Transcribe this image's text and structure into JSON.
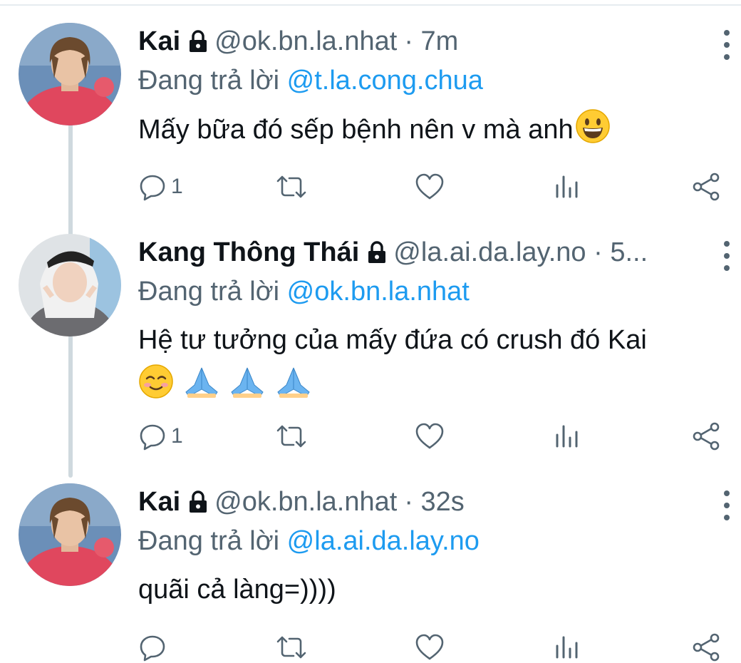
{
  "tweets": [
    {
      "name": "Kai",
      "handle": "@ok.bn.la.nhat",
      "time": "· 7m",
      "replying_label": "Đang trả lời",
      "replying_to": "@t.la.cong.chua",
      "text": "Mấy bữa đó sếp bệnh nên v mà anh",
      "emojis": [
        "grinning-face"
      ],
      "reply_count": "1",
      "avatar": "avatar-kai"
    },
    {
      "name": "Kang Thông Thái",
      "handle": "@la.ai.da.lay.no · 5...",
      "time": "",
      "replying_label": "Đang trả lời",
      "replying_to": "@ok.bn.la.nhat",
      "text": "Hệ tư tưởng của mấy đứa có crush đó Kai",
      "emojis": [
        "smiling-face",
        "folded-hands",
        "folded-hands",
        "folded-hands"
      ],
      "reply_count": "1",
      "avatar": "avatar-kang"
    },
    {
      "name": "Kai",
      "handle": "@ok.bn.la.nhat",
      "time": "· 32s",
      "replying_label": "Đang trả lời",
      "replying_to": "@la.ai.da.lay.no",
      "text": "quãi cả làng=))))",
      "emojis": [],
      "reply_count": "",
      "avatar": "avatar-kai"
    }
  ],
  "icons": {
    "lock": "lock-icon",
    "more": "more-vertical-icon",
    "reply": "reply-icon",
    "retweet": "retweet-icon",
    "like": "heart-icon",
    "views": "analytics-icon",
    "share": "share-icon"
  },
  "colors": {
    "link": "#1d9bf0",
    "secondary": "#536471",
    "text": "#0f1419",
    "thread_line": "#cfd9de"
  }
}
